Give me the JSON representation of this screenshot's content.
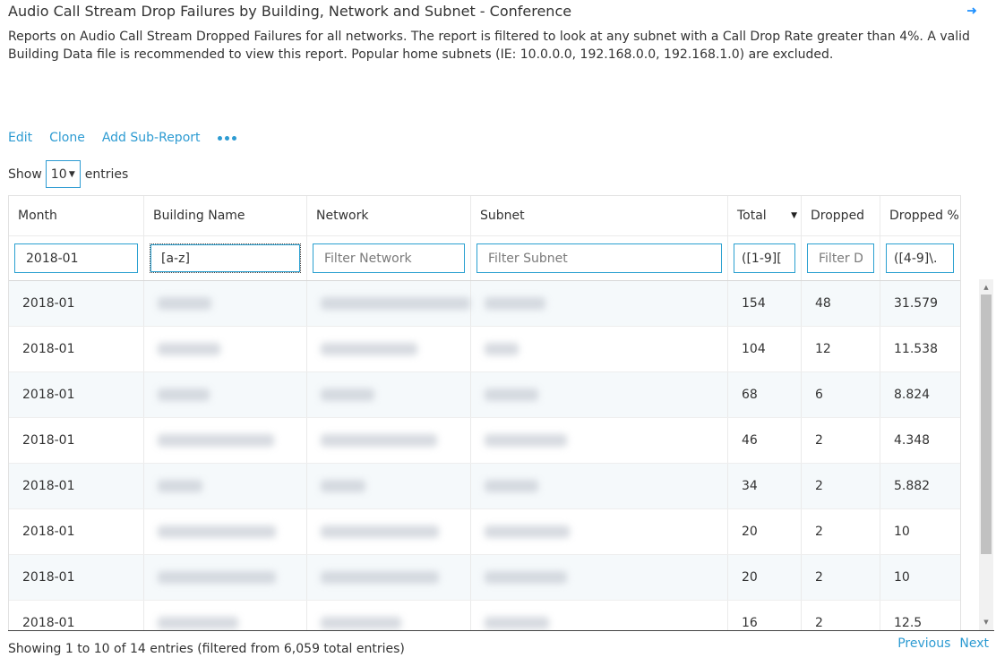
{
  "report": {
    "title": "Audio Call Stream Drop Failures by Building, Network and Subnet - Conference",
    "description": "Reports on Audio Call Stream Dropped Failures for all networks. The report is filtered to look at any subnet with a Call Drop Rate greater than 4%. A valid Building Data file is recommended to view this report. Popular home subnets (IE: 10.0.0.0, 192.168.0.0, 192.168.1.0) are excluded."
  },
  "actions": {
    "edit": "Edit",
    "clone": "Clone",
    "add_sub_report": "Add Sub-Report"
  },
  "length": {
    "show": "Show",
    "value": "10",
    "entries": "entries"
  },
  "columns": {
    "month": "Month",
    "building": "Building Name",
    "network": "Network",
    "subnet": "Subnet",
    "total": "Total",
    "dropped": "Dropped",
    "dropped_pct": "Dropped %"
  },
  "filters": {
    "month_value": "2018-01",
    "building_value": "[a-z]",
    "network_placeholder": "Filter Network",
    "subnet_placeholder": "Filter Subnet",
    "total_value": "([1-9][",
    "dropped_placeholder": "Filter D",
    "dropped_pct_value": "([4-9]\\."
  },
  "rows": [
    {
      "month": "2018-01",
      "total": "154",
      "dropped": "48",
      "pct": "31.579"
    },
    {
      "month": "2018-01",
      "total": "104",
      "dropped": "12",
      "pct": "11.538"
    },
    {
      "month": "2018-01",
      "total": "68",
      "dropped": "6",
      "pct": "8.824"
    },
    {
      "month": "2018-01",
      "total": "46",
      "dropped": "2",
      "pct": "4.348"
    },
    {
      "month": "2018-01",
      "total": "34",
      "dropped": "2",
      "pct": "5.882"
    },
    {
      "month": "2018-01",
      "total": "20",
      "dropped": "2",
      "pct": "10"
    },
    {
      "month": "2018-01",
      "total": "20",
      "dropped": "2",
      "pct": "10"
    },
    {
      "month": "2018-01",
      "total": "16",
      "dropped": "2",
      "pct": "12.5"
    }
  ],
  "footer": {
    "info": "Showing 1 to 10 of 14 entries (filtered from 6,059 total entries)",
    "previous": "Previous",
    "next": "Next"
  },
  "icons": {
    "title_arrow": "arrow-right-icon",
    "more": "more-dots-icon",
    "sort": "sort-desc-icon"
  },
  "colors": {
    "accent": "#2d9bd2",
    "row_stripe": "#f5f9fb"
  }
}
